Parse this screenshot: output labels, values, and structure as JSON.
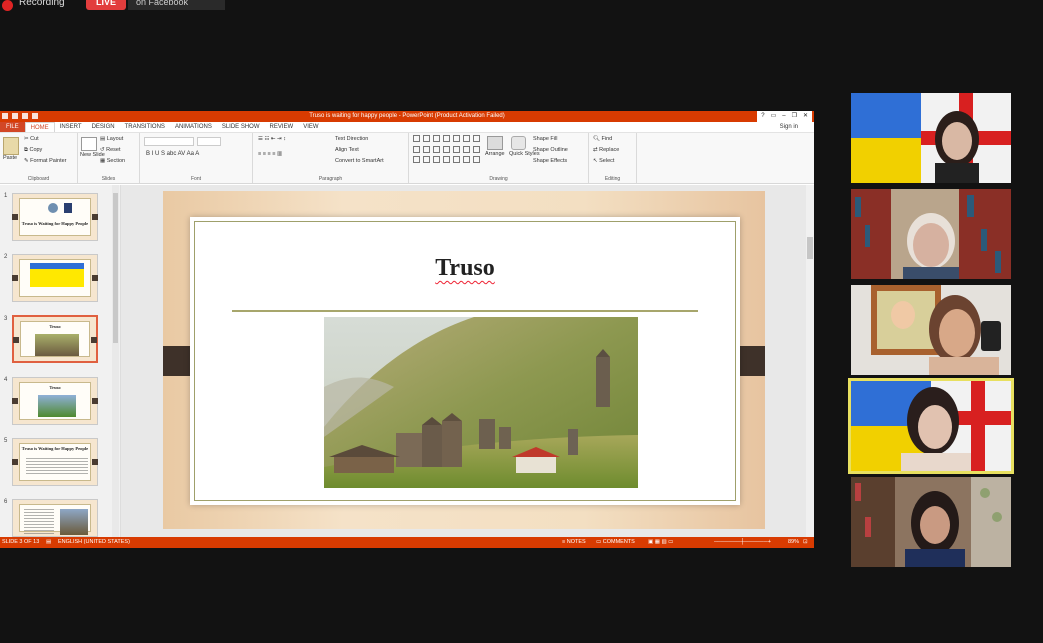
{
  "recording": {
    "label": "Recording",
    "live": "LIVE",
    "destination": "on Facebook"
  },
  "ppt": {
    "window_title": "Truso is waiting for happy people -  PowerPoint (Product Activation Failed)",
    "window_buttons": [
      "?",
      "▭",
      "–",
      "❐",
      "✕"
    ],
    "tabs": [
      "FILE",
      "HOME",
      "INSERT",
      "DESIGN",
      "TRANSITIONS",
      "ANIMATIONS",
      "SLIDE SHOW",
      "REVIEW",
      "VIEW"
    ],
    "active_tab": "HOME",
    "sign_in": "Sign in",
    "ribbon": {
      "clipboard": {
        "label": "Clipboard",
        "paste": "Paste",
        "cut": "Cut",
        "copy": "Copy",
        "format_painter": "Format Painter"
      },
      "slides": {
        "label": "Slides",
        "new_slide": "New Slide",
        "layout": "Layout",
        "reset": "Reset",
        "section": "Section"
      },
      "font": {
        "label": "Font",
        "buttons": "B  I  U  S  abc  AV  Aa  A"
      },
      "paragraph": {
        "label": "Paragraph",
        "text_direction": "Text Direction",
        "align_text": "Align Text",
        "smartart": "Convert to SmartArt"
      },
      "drawing": {
        "label": "Drawing",
        "arrange": "Arrange",
        "quick_styles": "Quick Styles",
        "shape_fill": "Shape Fill",
        "shape_outline": "Shape Outline",
        "shape_effects": "Shape Effects"
      },
      "editing": {
        "label": "Editing",
        "find": "Find",
        "replace": "Replace",
        "select": "Select"
      }
    },
    "thumbnails": [
      {
        "num": "1",
        "title": "Truso is Waiting for Happy People"
      },
      {
        "num": "2",
        "title": ""
      },
      {
        "num": "3",
        "title": "Truso"
      },
      {
        "num": "4",
        "title": "Truso"
      },
      {
        "num": "5",
        "title": "Truso is Waiting for Happy People"
      },
      {
        "num": "6",
        "title": ""
      }
    ],
    "slide": {
      "title": "Truso"
    },
    "status": {
      "slide_count": "SLIDE 3 OF 13",
      "language": "ENGLISH (UNITED STATES)",
      "notes": "NOTES",
      "comments": "COMMENTS",
      "zoom": "89%"
    }
  },
  "participants": [
    {
      "name": "participant-1"
    },
    {
      "name": "participant-2"
    },
    {
      "name": "participant-3"
    },
    {
      "name": "participant-4",
      "speaking": true
    },
    {
      "name": "participant-5"
    }
  ],
  "colors": {
    "ppt_accent": "#d83b01",
    "speaking_border": "#e8e060"
  }
}
